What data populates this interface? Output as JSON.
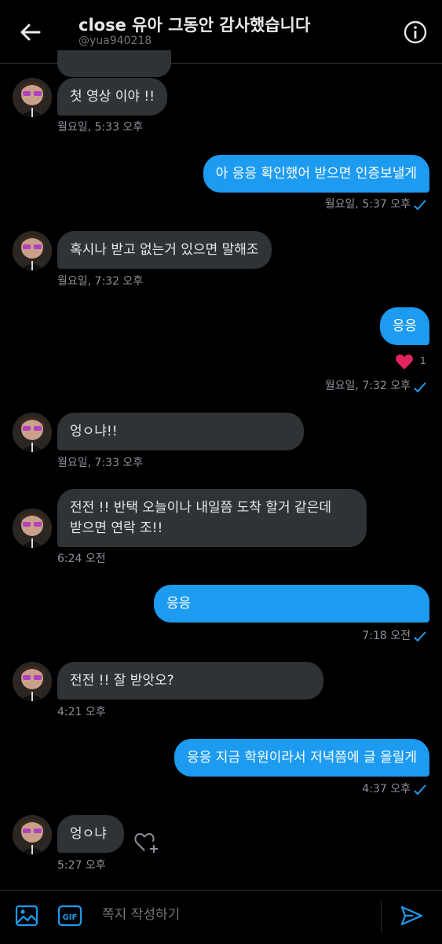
{
  "header": {
    "title": "close 유아 그동안 감사했습니다",
    "handle": "@yua940218"
  },
  "messages": [
    {
      "dir": "in",
      "text": "첫 영상 이야 !!",
      "time": "월요일, 5:33 오후"
    },
    {
      "dir": "out",
      "text": "아 응응 확인했어 받으면 인증보낼게",
      "time": "월요일, 5:37 오후"
    },
    {
      "dir": "in",
      "text": "혹시나 받고 없는거 있으면 말해조",
      "time": "월요일, 7:32 오후"
    },
    {
      "dir": "out",
      "text": "응응",
      "time": "월요일, 7:32 오후",
      "reaction_count": "1"
    },
    {
      "dir": "in",
      "text": "엉ㅇ냐!!",
      "time": "월요일, 7:33 오후"
    },
    {
      "dir": "in",
      "line1": "전전 !! 반택 오늘이나 내일쯤 도착 할거 같은데",
      "line2": "받으면 연락 조!!",
      "time": "6:24 오전"
    },
    {
      "dir": "out",
      "text": "응응",
      "time": "7:18 오전"
    },
    {
      "dir": "in",
      "text": "전전 !! 잘 받앗오?",
      "time": "4:21 오후"
    },
    {
      "dir": "out",
      "text": "응응 지금 학원이라서 저녁쯤에 글 올릴게",
      "time": "4:37 오후"
    },
    {
      "dir": "in",
      "text": "엉ㅇ냐",
      "time": "5:27 오후"
    }
  ],
  "composer": {
    "placeholder": "쪽지 작성하기",
    "gif_label": "GIF"
  },
  "colors": {
    "background": "#000000",
    "incoming_bubble": "#2f3336",
    "outgoing_bubble": "#1d9bf0",
    "accent": "#1d9bf0",
    "heart": "#f91880"
  }
}
